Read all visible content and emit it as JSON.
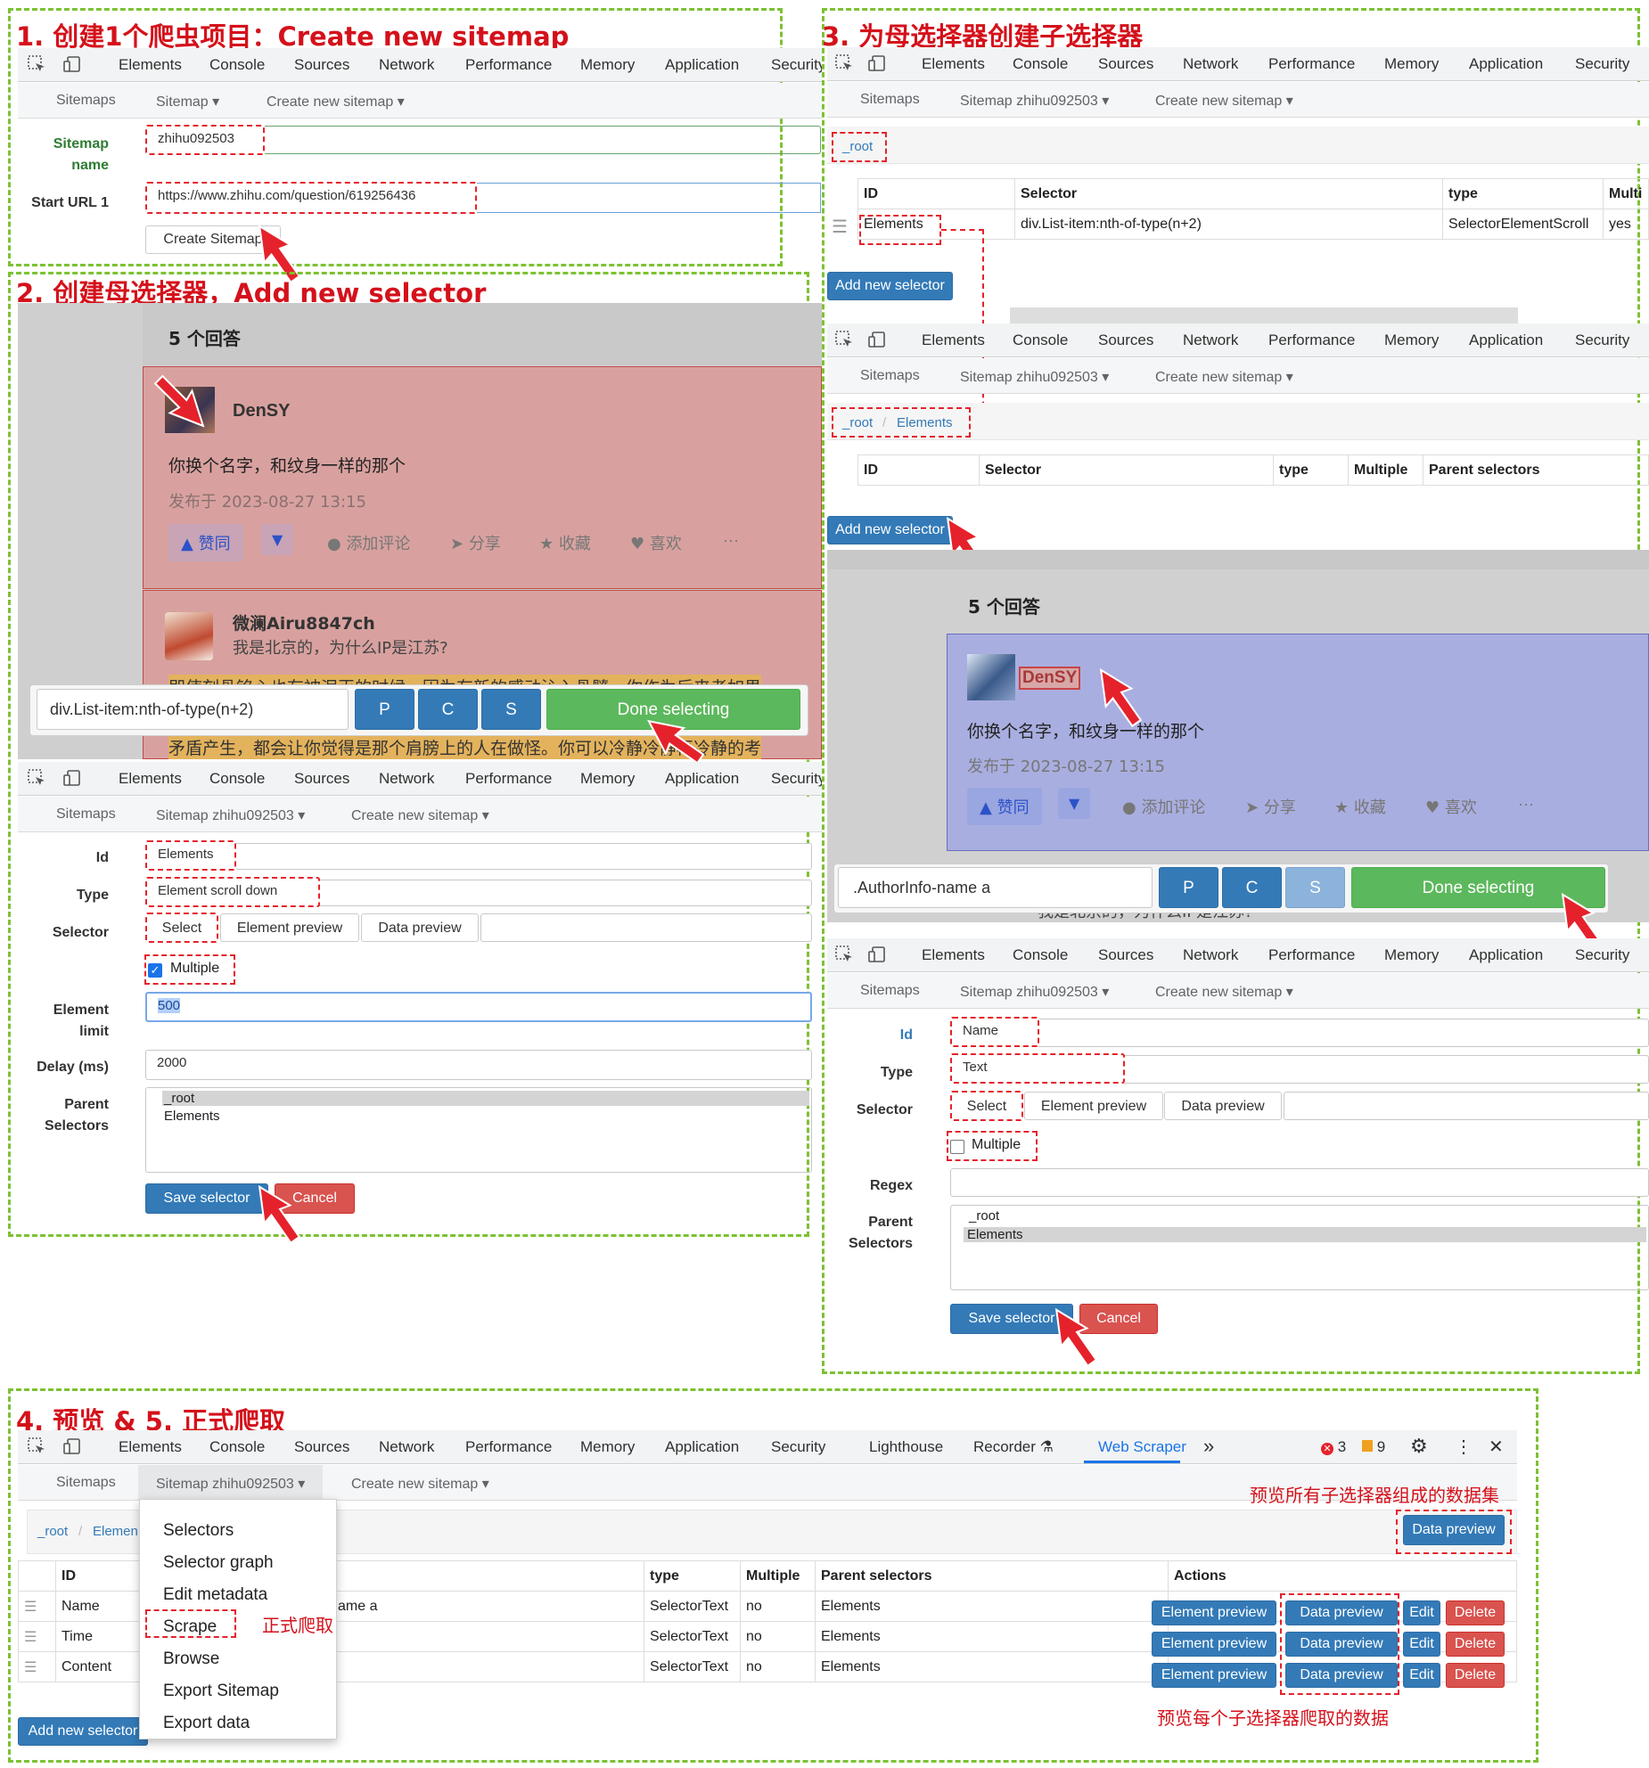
{
  "devtools": {
    "tabs": [
      "Elements",
      "Console",
      "Sources",
      "Network",
      "Performance",
      "Memory",
      "Application",
      "Security"
    ],
    "tabs_extended": [
      "Elements",
      "Console",
      "Sources",
      "Network",
      "Performance",
      "Memory",
      "Application",
      "Security",
      "Lighthouse",
      "Recorder ⚗",
      "Web Scraper"
    ],
    "more": "»",
    "errors": "3",
    "warnings": "9"
  },
  "scraper_nav": {
    "sitemaps": "Sitemaps",
    "sitemap": "Sitemap",
    "sitemap_named": "Sitemap zhihu092503",
    "create": "Create new sitemap"
  },
  "panel1": {
    "title": "1. 创建1个爬虫项目：Create new sitemap",
    "sitemap_name_label1": "Sitemap",
    "sitemap_name_label2": "name",
    "sitemap_name_value": "zhihu092503",
    "start_url_label": "Start URL 1",
    "start_url_value": "https://www.zhihu.com/question/619256436",
    "create_button": "Create Sitemap"
  },
  "panel2": {
    "title": "2. 创建母选择器，Add new selector",
    "answers_count": "5 个回答",
    "answer1": {
      "author": "DenSY",
      "text": "你换个名字，和纹身一样的那个",
      "date": "发布于 2023-08-27 13:15",
      "upvote": "▲ 赞同",
      "comment": "添加评论",
      "share": "分享",
      "collect": "收藏",
      "like": "喜欢",
      "more": "···"
    },
    "answer2": {
      "author": "微澜Airu8847ch",
      "text": "我是北京的，为什么IP是江苏?",
      "body1": "即使刻骨铭心也有被泯灭的时候，因为有新的感动沁入骨髓，你作为后来者如果",
      "body2": "矛盾产生，都会让你觉得是那个肩膀上的人在做怪。你可以冷静冷静再冷静的考"
    },
    "selector_bar": {
      "value": "div.List-item:nth-of-type(n+2)",
      "p": "P",
      "c": "C",
      "s": "S",
      "done": "Done selecting"
    },
    "form": {
      "id_label": "Id",
      "id_value": "Elements",
      "type_label": "Type",
      "type_value": "Element scroll down",
      "selector_label": "Selector",
      "select_btn": "Select",
      "element_preview_btn": "Element preview",
      "data_preview_btn": "Data preview",
      "multiple_label": "Multiple",
      "element_limit_label1": "Element",
      "element_limit_label2": "limit",
      "element_limit_value": "500",
      "delay_label": "Delay (ms)",
      "delay_value": "2000",
      "parent_label1": "Parent",
      "parent_label2": "Selectors",
      "parent_options": [
        "_root",
        "Elements"
      ],
      "save": "Save selector",
      "cancel": "Cancel"
    }
  },
  "panel3": {
    "title": "3. 为母选择器创建子选择器",
    "breadcrumb_root": "_root",
    "breadcrumb_elements": "Elements",
    "table_headers": [
      "ID",
      "Selector",
      "type",
      "Multi"
    ],
    "row": {
      "id": "Elements",
      "selector": "div.List-item:nth-of-type(n+2)",
      "type": "SelectorElementScroll",
      "multiple": "yes"
    },
    "add_selector": "Add new selector",
    "table2_headers": [
      "ID",
      "Selector",
      "type",
      "Multiple",
      "Parent selectors"
    ],
    "answers_count": "5 个回答",
    "author": "DenSY",
    "text": "你换个名字，和纹身一样的那个",
    "date": "发布于 2023-08-27 13:15",
    "upvote": "▲ 赞同",
    "comment": "添加评论",
    "share": "分享",
    "collect": "收藏",
    "like": "喜欢",
    "more": "···",
    "cut_text": "我是北京的，为什么IP是江苏?",
    "selector_bar": {
      "value": ".AuthorInfo-name a",
      "p": "P",
      "c": "C",
      "s": "S",
      "done": "Done selecting"
    },
    "form": {
      "id_label": "Id",
      "id_value": "Name",
      "type_label": "Type",
      "type_value": "Text",
      "selector_label": "Selector",
      "select_btn": "Select",
      "element_preview_btn": "Element preview",
      "data_preview_btn": "Data preview",
      "multiple_label": "Multiple",
      "regex_label": "Regex",
      "parent_label1": "Parent",
      "parent_label2": "Selectors",
      "parent_options": [
        "_root",
        "Elements"
      ],
      "save": "Save selector",
      "cancel": "Cancel"
    }
  },
  "panel4": {
    "title": "4. 预览 & 5. 正式爬取",
    "breadcrumb_root": "_root",
    "breadcrumb_elements": "Elemen",
    "annotation_all": "预览所有子选择器组成的数据集",
    "annotation_scrape": "正式爬取",
    "annotation_each": "预览每个子选择器爬取的数据",
    "data_preview_top": "Data preview",
    "menu": [
      "Selectors",
      "Selector graph",
      "Edit metadata",
      "Scrape",
      "Browse",
      "Export Sitemap",
      "Export data"
    ],
    "table_headers": [
      "ID",
      "type",
      "Multiple",
      "Parent selectors",
      "Actions"
    ],
    "rows": [
      {
        "id": "Name",
        "sel": "ame a",
        "type": "SelectorText",
        "multiple": "no",
        "parent": "Elements"
      },
      {
        "id": "Time",
        "sel": "",
        "type": "SelectorText",
        "multiple": "no",
        "parent": "Elements"
      },
      {
        "id": "Content",
        "sel": "",
        "type": "SelectorText",
        "multiple": "no",
        "parent": "Elements"
      }
    ],
    "actions": {
      "element_preview": "Element preview",
      "data_preview": "Data preview",
      "edit": "Edit",
      "delete": "Delete"
    },
    "add_selector": "Add new selector"
  },
  "colors": {
    "annotation_red": "#d4111b",
    "panel_border": "#7cc233",
    "primary": "#337ab7",
    "danger": "#d9534f",
    "success": "#5cb85c",
    "highlight_red": "#e5a6a6",
    "highlight_blue": "#a9aee0"
  }
}
